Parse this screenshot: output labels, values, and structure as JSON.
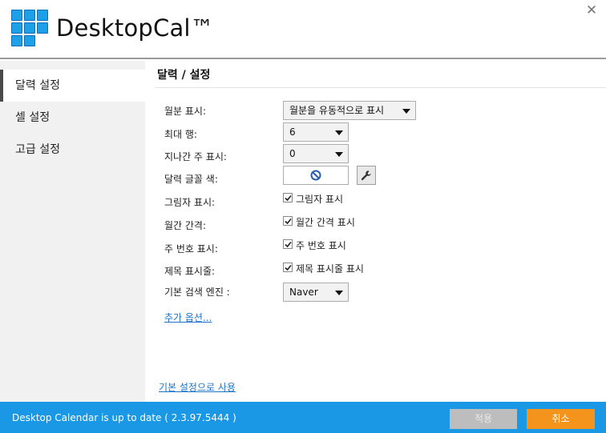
{
  "app": {
    "title": "DesktopCal™",
    "close_icon": "close-icon"
  },
  "sidebar": {
    "items": [
      {
        "label": "달력 설정",
        "active": true
      },
      {
        "label": "셀 설정",
        "active": false
      },
      {
        "label": "고급 설정",
        "active": false
      }
    ]
  },
  "main": {
    "title": "달력 / 설정",
    "rows": {
      "month_display": {
        "label": "월분 표시:",
        "value": "월분을 유동적으로 표시"
      },
      "max_rows": {
        "label": "최대 행:",
        "value": "6"
      },
      "past_weeks": {
        "label": "지나간 주 표시:",
        "value": "0"
      },
      "font_color": {
        "label": "달력 글꼴 색:",
        "icon": "no-color-icon",
        "button_icon": "wrench-icon"
      },
      "shadow": {
        "label": "그림자 표시:",
        "checkbox": "그림자 표시",
        "checked": true
      },
      "month_gap": {
        "label": "월간 간격:",
        "checkbox": "월간 간격 표시",
        "checked": true
      },
      "week_number": {
        "label": "주 번호 표시:",
        "checkbox": "주 번호 표시",
        "checked": true
      },
      "title_bar": {
        "label": "제목 표시줄:",
        "checkbox": "제목 표시줄 표시",
        "checked": true
      },
      "search_engine": {
        "label": "기본 검색 엔진 :",
        "value": "Naver"
      }
    },
    "more_options": "추가 옵션...",
    "use_default": "기본 설정으로 사용"
  },
  "footer": {
    "status": "Desktop Calendar is up to date ( 2.3.97.5444 )",
    "apply_label": "적용",
    "cancel_label": "취소"
  },
  "colors": {
    "accent": "#1a98e6",
    "logo": "#1ea0e8",
    "cancel": "#f5941d",
    "apply_disabled": "#bdbdbd",
    "link": "#1e74c9"
  }
}
